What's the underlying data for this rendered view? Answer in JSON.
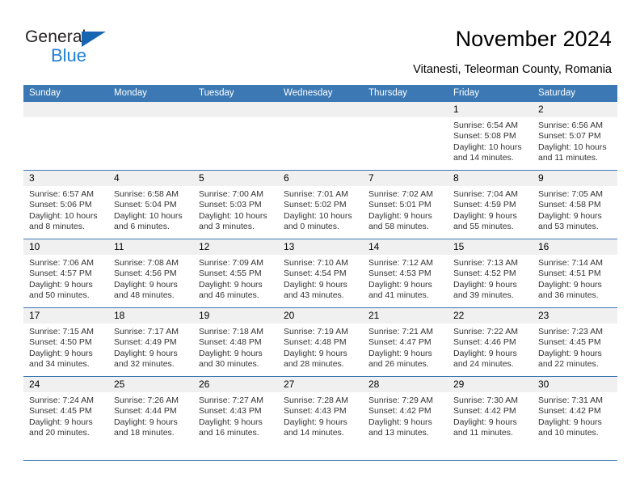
{
  "brand": {
    "name_part1": "General",
    "name_part2": "Blue",
    "logo_icon": "blue-triangle-icon"
  },
  "header": {
    "title": "November 2024",
    "subtitle": "Vitanesti, Teleorman County, Romania"
  },
  "calendar": {
    "weekday_headers": [
      "Sunday",
      "Monday",
      "Tuesday",
      "Wednesday",
      "Thursday",
      "Friday",
      "Saturday"
    ],
    "accent_color": "#3b78b4",
    "daynum_band_color": "#f0f0f0",
    "weeks": [
      [
        {
          "day": "",
          "sunrise": "",
          "sunset": "",
          "daylight_1": "",
          "daylight_2": ""
        },
        {
          "day": "",
          "sunrise": "",
          "sunset": "",
          "daylight_1": "",
          "daylight_2": ""
        },
        {
          "day": "",
          "sunrise": "",
          "sunset": "",
          "daylight_1": "",
          "daylight_2": ""
        },
        {
          "day": "",
          "sunrise": "",
          "sunset": "",
          "daylight_1": "",
          "daylight_2": ""
        },
        {
          "day": "",
          "sunrise": "",
          "sunset": "",
          "daylight_1": "",
          "daylight_2": ""
        },
        {
          "day": "1",
          "sunrise": "Sunrise: 6:54 AM",
          "sunset": "Sunset: 5:08 PM",
          "daylight_1": "Daylight: 10 hours",
          "daylight_2": "and 14 minutes."
        },
        {
          "day": "2",
          "sunrise": "Sunrise: 6:56 AM",
          "sunset": "Sunset: 5:07 PM",
          "daylight_1": "Daylight: 10 hours",
          "daylight_2": "and 11 minutes."
        }
      ],
      [
        {
          "day": "3",
          "sunrise": "Sunrise: 6:57 AM",
          "sunset": "Sunset: 5:06 PM",
          "daylight_1": "Daylight: 10 hours",
          "daylight_2": "and 8 minutes."
        },
        {
          "day": "4",
          "sunrise": "Sunrise: 6:58 AM",
          "sunset": "Sunset: 5:04 PM",
          "daylight_1": "Daylight: 10 hours",
          "daylight_2": "and 6 minutes."
        },
        {
          "day": "5",
          "sunrise": "Sunrise: 7:00 AM",
          "sunset": "Sunset: 5:03 PM",
          "daylight_1": "Daylight: 10 hours",
          "daylight_2": "and 3 minutes."
        },
        {
          "day": "6",
          "sunrise": "Sunrise: 7:01 AM",
          "sunset": "Sunset: 5:02 PM",
          "daylight_1": "Daylight: 10 hours",
          "daylight_2": "and 0 minutes."
        },
        {
          "day": "7",
          "sunrise": "Sunrise: 7:02 AM",
          "sunset": "Sunset: 5:01 PM",
          "daylight_1": "Daylight: 9 hours",
          "daylight_2": "and 58 minutes."
        },
        {
          "day": "8",
          "sunrise": "Sunrise: 7:04 AM",
          "sunset": "Sunset: 4:59 PM",
          "daylight_1": "Daylight: 9 hours",
          "daylight_2": "and 55 minutes."
        },
        {
          "day": "9",
          "sunrise": "Sunrise: 7:05 AM",
          "sunset": "Sunset: 4:58 PM",
          "daylight_1": "Daylight: 9 hours",
          "daylight_2": "and 53 minutes."
        }
      ],
      [
        {
          "day": "10",
          "sunrise": "Sunrise: 7:06 AM",
          "sunset": "Sunset: 4:57 PM",
          "daylight_1": "Daylight: 9 hours",
          "daylight_2": "and 50 minutes."
        },
        {
          "day": "11",
          "sunrise": "Sunrise: 7:08 AM",
          "sunset": "Sunset: 4:56 PM",
          "daylight_1": "Daylight: 9 hours",
          "daylight_2": "and 48 minutes."
        },
        {
          "day": "12",
          "sunrise": "Sunrise: 7:09 AM",
          "sunset": "Sunset: 4:55 PM",
          "daylight_1": "Daylight: 9 hours",
          "daylight_2": "and 46 minutes."
        },
        {
          "day": "13",
          "sunrise": "Sunrise: 7:10 AM",
          "sunset": "Sunset: 4:54 PM",
          "daylight_1": "Daylight: 9 hours",
          "daylight_2": "and 43 minutes."
        },
        {
          "day": "14",
          "sunrise": "Sunrise: 7:12 AM",
          "sunset": "Sunset: 4:53 PM",
          "daylight_1": "Daylight: 9 hours",
          "daylight_2": "and 41 minutes."
        },
        {
          "day": "15",
          "sunrise": "Sunrise: 7:13 AM",
          "sunset": "Sunset: 4:52 PM",
          "daylight_1": "Daylight: 9 hours",
          "daylight_2": "and 39 minutes."
        },
        {
          "day": "16",
          "sunrise": "Sunrise: 7:14 AM",
          "sunset": "Sunset: 4:51 PM",
          "daylight_1": "Daylight: 9 hours",
          "daylight_2": "and 36 minutes."
        }
      ],
      [
        {
          "day": "17",
          "sunrise": "Sunrise: 7:15 AM",
          "sunset": "Sunset: 4:50 PM",
          "daylight_1": "Daylight: 9 hours",
          "daylight_2": "and 34 minutes."
        },
        {
          "day": "18",
          "sunrise": "Sunrise: 7:17 AM",
          "sunset": "Sunset: 4:49 PM",
          "daylight_1": "Daylight: 9 hours",
          "daylight_2": "and 32 minutes."
        },
        {
          "day": "19",
          "sunrise": "Sunrise: 7:18 AM",
          "sunset": "Sunset: 4:48 PM",
          "daylight_1": "Daylight: 9 hours",
          "daylight_2": "and 30 minutes."
        },
        {
          "day": "20",
          "sunrise": "Sunrise: 7:19 AM",
          "sunset": "Sunset: 4:48 PM",
          "daylight_1": "Daylight: 9 hours",
          "daylight_2": "and 28 minutes."
        },
        {
          "day": "21",
          "sunrise": "Sunrise: 7:21 AM",
          "sunset": "Sunset: 4:47 PM",
          "daylight_1": "Daylight: 9 hours",
          "daylight_2": "and 26 minutes."
        },
        {
          "day": "22",
          "sunrise": "Sunrise: 7:22 AM",
          "sunset": "Sunset: 4:46 PM",
          "daylight_1": "Daylight: 9 hours",
          "daylight_2": "and 24 minutes."
        },
        {
          "day": "23",
          "sunrise": "Sunrise: 7:23 AM",
          "sunset": "Sunset: 4:45 PM",
          "daylight_1": "Daylight: 9 hours",
          "daylight_2": "and 22 minutes."
        }
      ],
      [
        {
          "day": "24",
          "sunrise": "Sunrise: 7:24 AM",
          "sunset": "Sunset: 4:45 PM",
          "daylight_1": "Daylight: 9 hours",
          "daylight_2": "and 20 minutes."
        },
        {
          "day": "25",
          "sunrise": "Sunrise: 7:26 AM",
          "sunset": "Sunset: 4:44 PM",
          "daylight_1": "Daylight: 9 hours",
          "daylight_2": "and 18 minutes."
        },
        {
          "day": "26",
          "sunrise": "Sunrise: 7:27 AM",
          "sunset": "Sunset: 4:43 PM",
          "daylight_1": "Daylight: 9 hours",
          "daylight_2": "and 16 minutes."
        },
        {
          "day": "27",
          "sunrise": "Sunrise: 7:28 AM",
          "sunset": "Sunset: 4:43 PM",
          "daylight_1": "Daylight: 9 hours",
          "daylight_2": "and 14 minutes."
        },
        {
          "day": "28",
          "sunrise": "Sunrise: 7:29 AM",
          "sunset": "Sunset: 4:42 PM",
          "daylight_1": "Daylight: 9 hours",
          "daylight_2": "and 13 minutes."
        },
        {
          "day": "29",
          "sunrise": "Sunrise: 7:30 AM",
          "sunset": "Sunset: 4:42 PM",
          "daylight_1": "Daylight: 9 hours",
          "daylight_2": "and 11 minutes."
        },
        {
          "day": "30",
          "sunrise": "Sunrise: 7:31 AM",
          "sunset": "Sunset: 4:42 PM",
          "daylight_1": "Daylight: 9 hours",
          "daylight_2": "and 10 minutes."
        }
      ]
    ]
  }
}
